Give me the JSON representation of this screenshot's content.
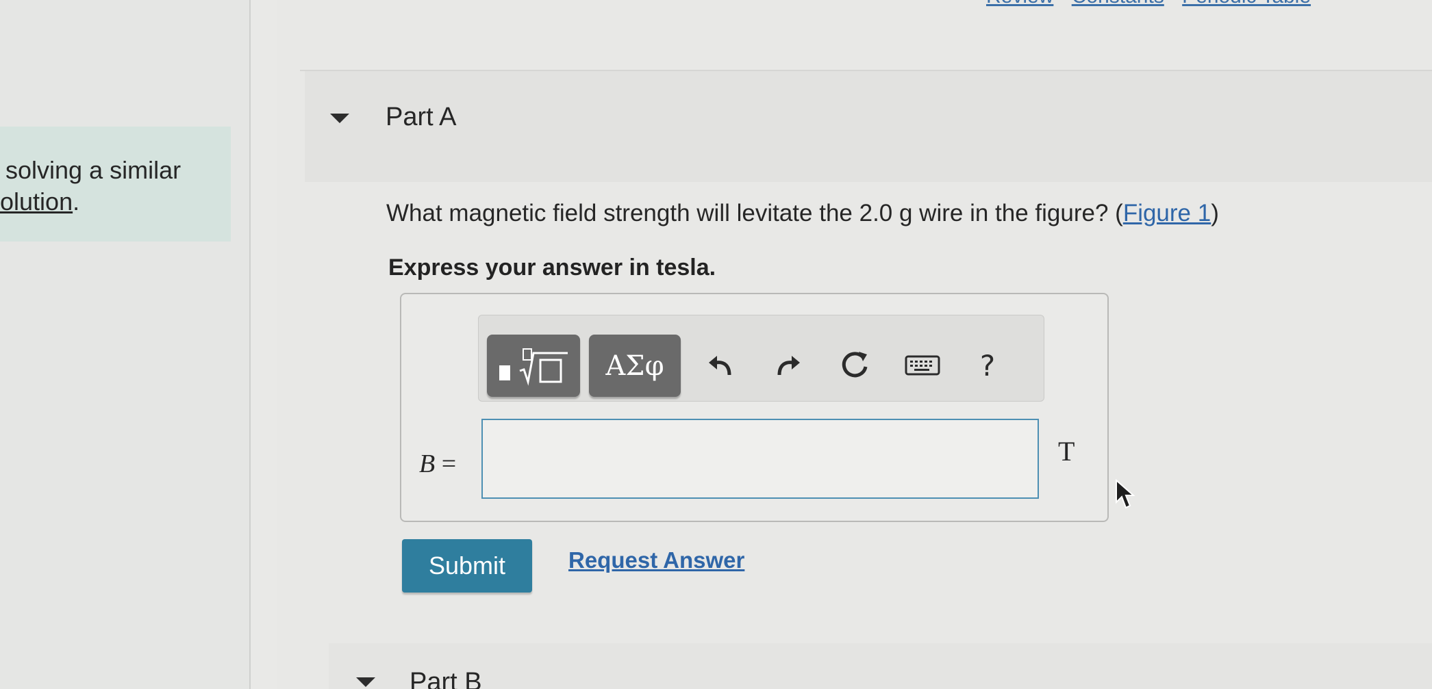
{
  "top_nav": {
    "items": [
      "Review",
      "Constants",
      "Periodic Table"
    ]
  },
  "sidebar": {
    "hint_line_1": "solving a similar",
    "hint_line_2_link": "olution",
    "hint_line_2_suffix": "."
  },
  "part_a": {
    "title": "Part A",
    "question_text": "What magnetic field strength will levitate the 2.0 g wire in the figure? (",
    "figure_link": "Figure 1",
    "question_close": ")",
    "instruction": "Express your answer in tesla.",
    "toolbar": {
      "templates_icon": "templates-icon",
      "symbols_label": "ΑΣφ",
      "undo_icon": "undo-icon",
      "redo_icon": "redo-icon",
      "reset_icon": "reset-icon",
      "keyboard_icon": "keyboard-icon",
      "help_label": "?"
    },
    "variable": "B",
    "equals": " =",
    "answer_value": "",
    "unit": "T",
    "submit_label": "Submit",
    "request_answer_label": "Request Answer"
  },
  "part_b": {
    "title": "Part B"
  },
  "colors": {
    "submit": "#2f7e9e",
    "link": "#2f66a8",
    "input_border": "#4d8fb3",
    "hint_bg": "#d5e3de",
    "toolbar_button": "#6a6a6a"
  }
}
